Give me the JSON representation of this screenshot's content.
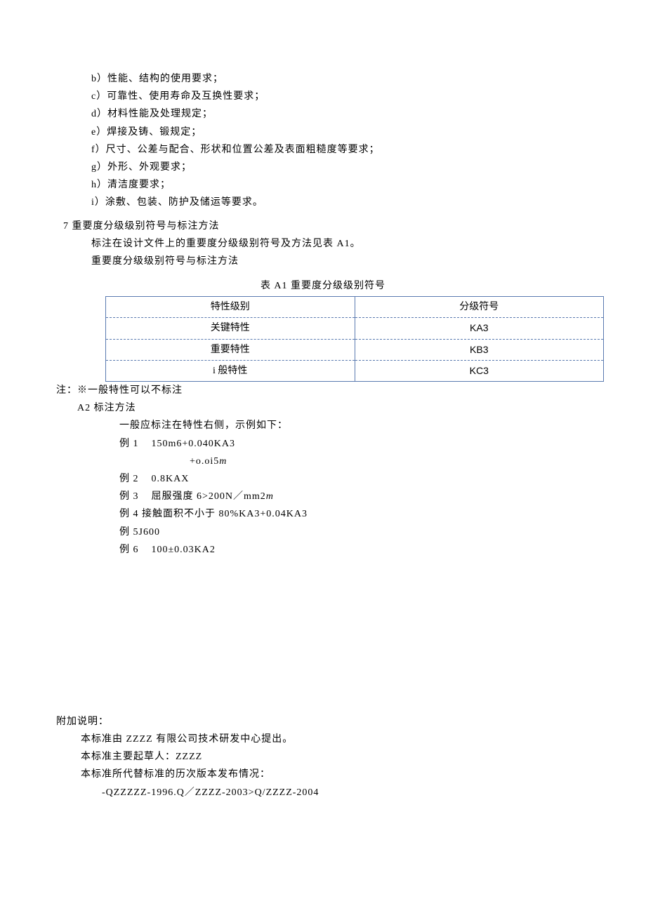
{
  "list_items": {
    "b": "b）性能、结构的使用要求；",
    "c": "c）可靠性、使用寿命及互换性要求；",
    "d": "d）材料性能及处理规定；",
    "e": "e）焊接及铸、锻规定；",
    "f": "f）尺寸、公差与配合、形状和位置公差及表面粗糙度等要求；",
    "g": "g）外形、外观要求；",
    "h": "h）清洁度要求；",
    "i": "i）涂敷、包装、防护及储运等要求。"
  },
  "section7_title": "7 重要度分级级别符号与标注方法",
  "section7_p1": "标注在设计文件上的重要度分级级别符号及方法见表 A1。",
  "section7_p2": "重要度分级级别符号与标注方法",
  "table_caption": "表 A1 重要度分级级别符号",
  "table": {
    "header": {
      "c1": "特性级别",
      "c2": "分级符号"
    },
    "rows": [
      {
        "c1": "关键特性",
        "c2": "KA3"
      },
      {
        "c1": "重要特性",
        "c2": "KB3"
      },
      {
        "c1": "i 般特性",
        "c2": "KC3"
      }
    ]
  },
  "note_text": "注：※一般特性可以不标注",
  "a2_title": "A2 标注方法",
  "a2_intro": "一般应标注在特性右侧，示例如下：",
  "ex1_label": "例 1",
  "ex1_val": "150m6+0.040KA3",
  "ex1_sub": "+o.oi5",
  "ex1_sub_suffix": "m",
  "ex2_label": "例 2",
  "ex2_val": "0.8KAX",
  "ex3_label": "例 3",
  "ex3_val": "屈服强度 6>200N／mm2",
  "ex3_suffix": "m",
  "ex4": "例 4 接触面积不小于 80%KA3+0.04KA3",
  "ex5": "例 5J600",
  "ex6_label": "例 6",
  "ex6_val": "100±0.03KA2",
  "appendix_title": "附加说明：",
  "appendix_p1": "本标准由 ZZZZ 有限公司技术研发中心提出。",
  "appendix_p2": "本标准主要起草人：ZZZZ",
  "appendix_p3": "本标准所代替标准的历次版本发布情况：",
  "appendix_p4": "-QZZZZZ-1996.Q／ZZZZ-2003>Q/ZZZZ-2004"
}
